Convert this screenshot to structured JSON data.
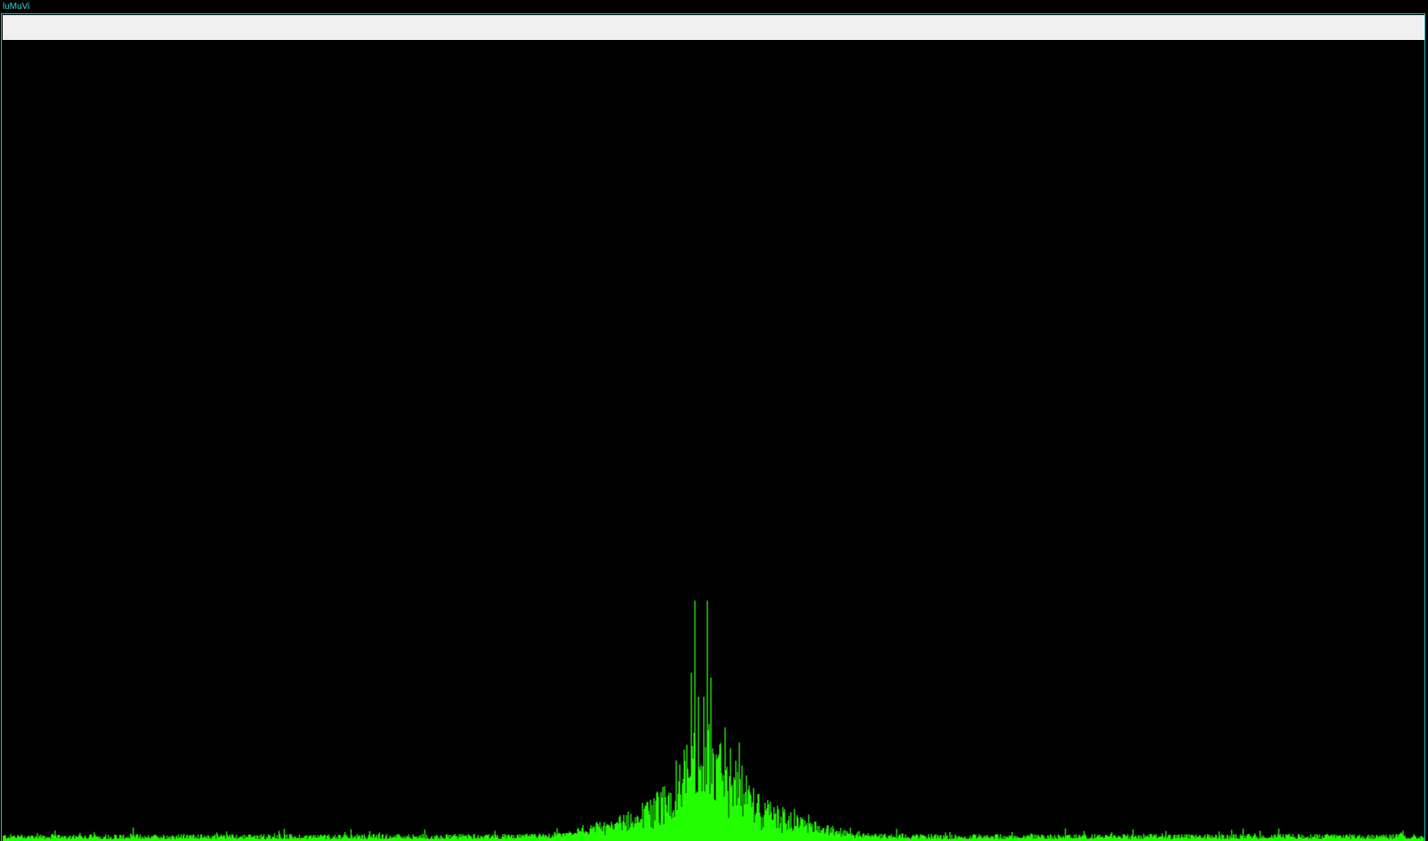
{
  "window": {
    "title": "luMuVi"
  },
  "visualizer": {
    "type": "frequency-spectrum",
    "bar_color": "#22ff00",
    "background_color": "#000000",
    "peak_level": 0.3
  },
  "theme": {
    "accent": "#2ad4d4",
    "toolbar_bg": "#f0f0f0"
  }
}
